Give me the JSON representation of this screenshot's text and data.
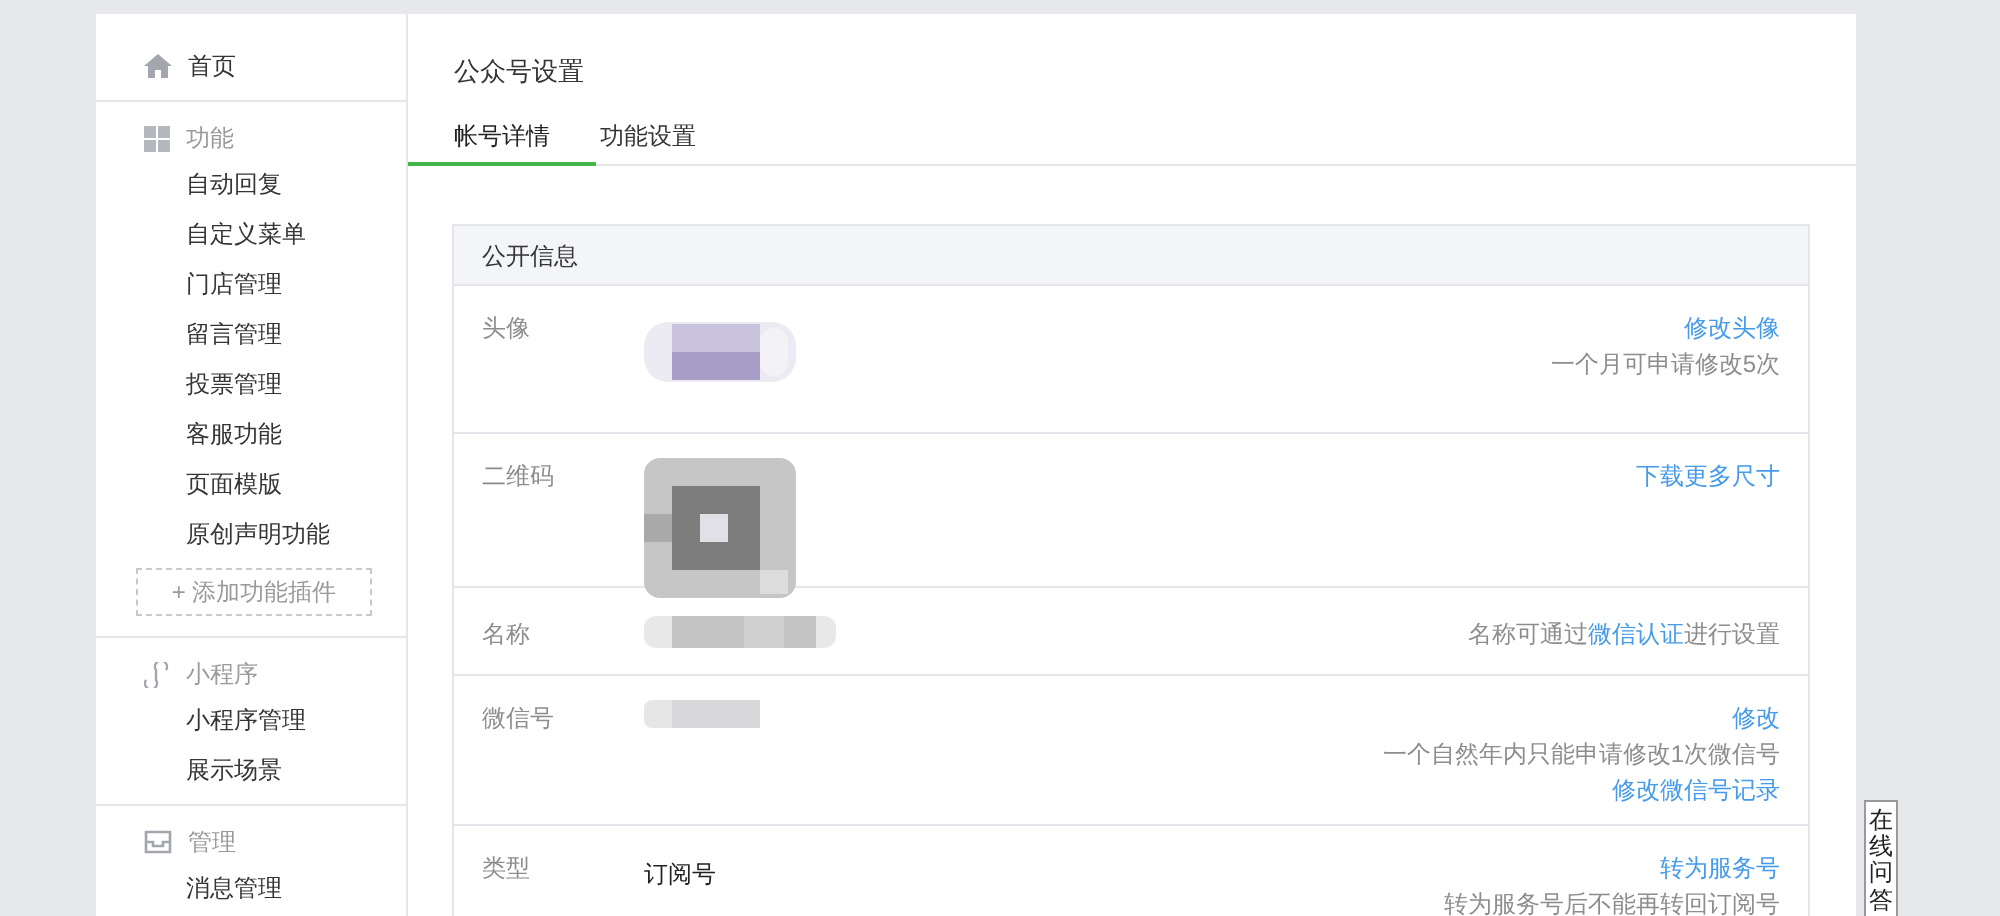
{
  "sidebar": {
    "sections": [
      {
        "title": "首页",
        "kind": "link"
      },
      {
        "title": "功能",
        "kind": "group",
        "items": [
          "自动回复",
          "自定义菜单",
          "门店管理",
          "留言管理",
          "投票管理",
          "客服功能",
          "页面模版",
          "原创声明功能"
        ],
        "add_button": "+ 添加功能插件"
      },
      {
        "title": "小程序",
        "kind": "group",
        "items": [
          "小程序管理",
          "展示场景"
        ]
      },
      {
        "title": "管理",
        "kind": "group",
        "items": [
          "消息管理"
        ]
      }
    ]
  },
  "page_title": "公众号设置",
  "tabs": [
    {
      "label": "帐号详情",
      "selected": true
    },
    {
      "label": "功能设置",
      "selected": false
    }
  ],
  "card": {
    "title": "公开信息",
    "rows": [
      {
        "label": "头像",
        "value": {
          "kind": "picture"
        },
        "notes": [
          [
            {
              "kind": "link",
              "text": "修改头像"
            }
          ],
          [
            {
              "kind": "text",
              "text": "一个月可申请修改5次"
            }
          ]
        ]
      },
      {
        "label": "二维码",
        "value": {
          "kind": "picture"
        },
        "notes": [
          [
            {
              "kind": "link",
              "text": "下载更多尺寸"
            }
          ]
        ]
      },
      {
        "label": "名称",
        "value": {
          "kind": "picture"
        },
        "notes": [
          [
            {
              "kind": "text",
              "text": "名称可通过"
            },
            {
              "kind": "link",
              "text": "微信认证"
            },
            {
              "kind": "text",
              "text": "进行设置"
            }
          ]
        ]
      },
      {
        "label": "微信号",
        "value": {
          "kind": "picture"
        },
        "notes": [
          [
            {
              "kind": "link",
              "text": "修改"
            }
          ],
          [
            {
              "kind": "text",
              "text": "一个自然年内只能申请修改1次微信号"
            }
          ],
          [
            {
              "kind": "link",
              "text": "修改微信号记录"
            }
          ]
        ]
      },
      {
        "label": "类型",
        "value": {
          "kind": "text",
          "text": "订阅号"
        },
        "notes": [
          [
            {
              "kind": "link",
              "text": "转为服务号"
            }
          ],
          [
            {
              "kind": "text",
              "text": "转为服务号后不能再转回订阅号"
            }
          ]
        ]
      }
    ]
  },
  "side_widget": "在线问答"
}
